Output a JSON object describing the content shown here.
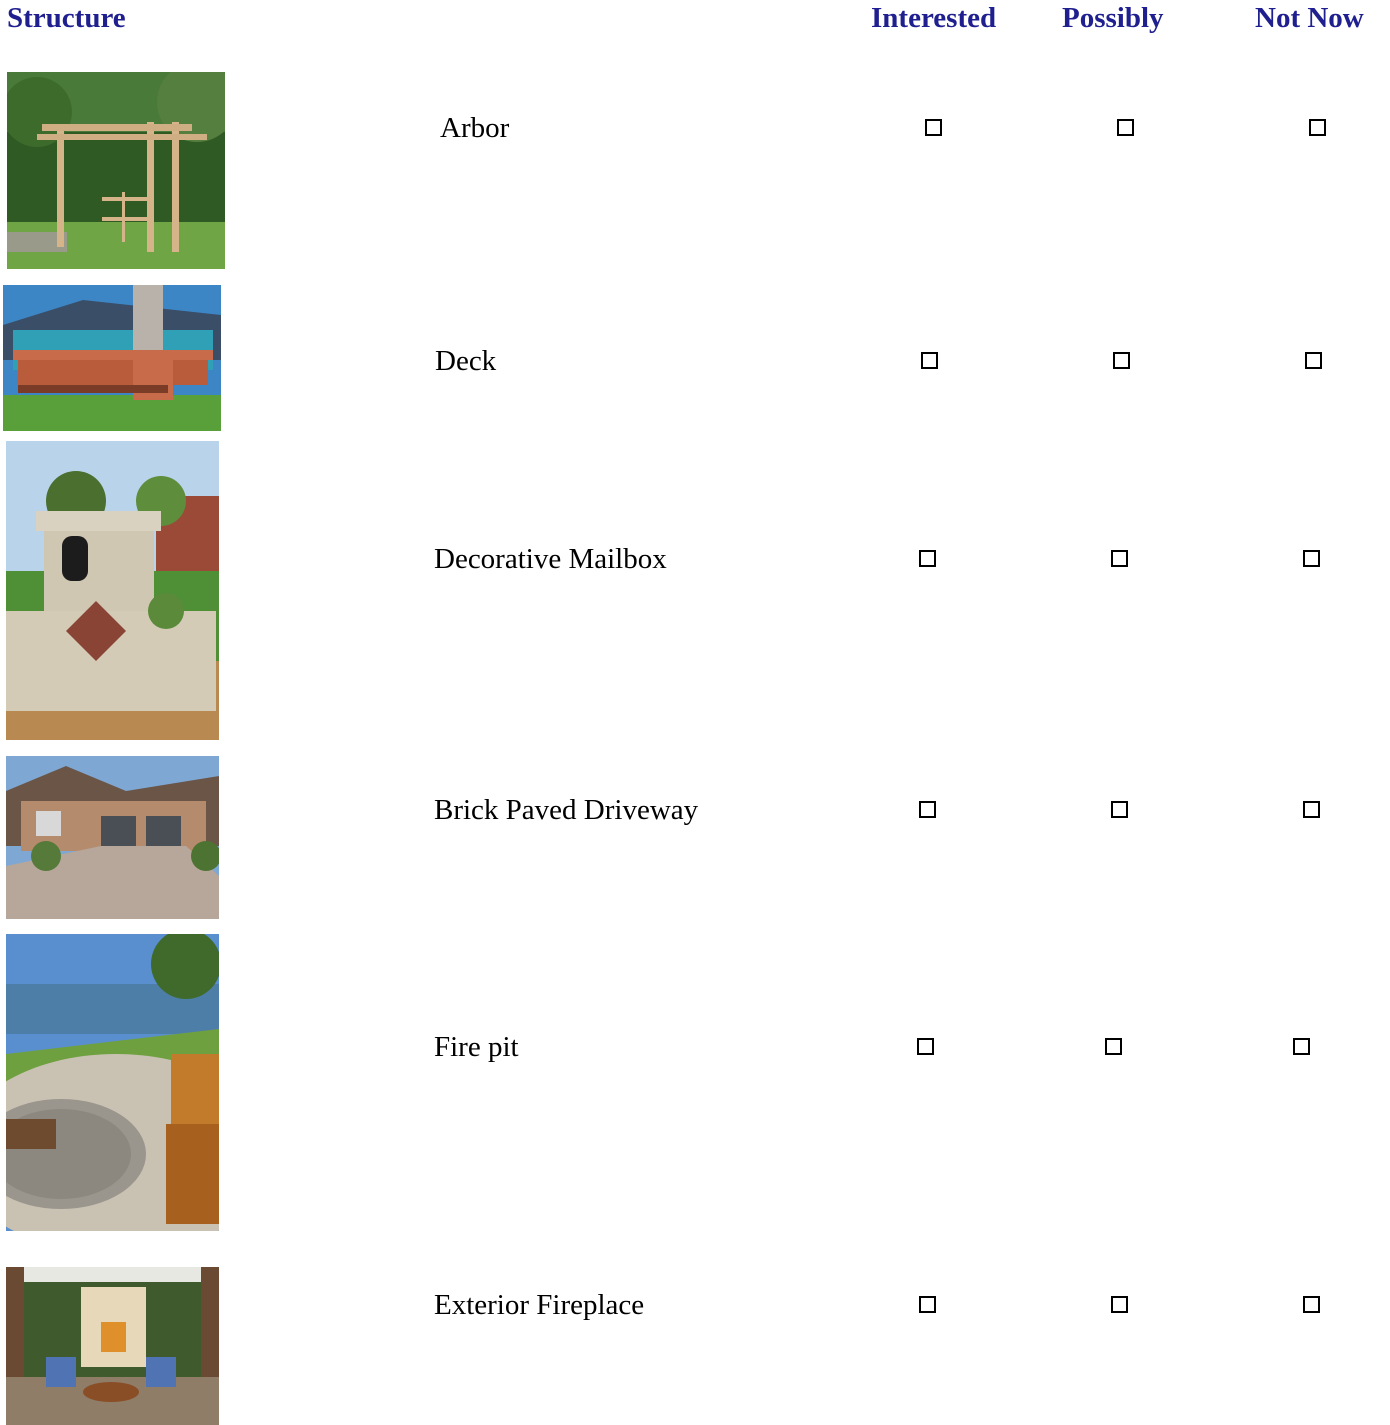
{
  "header": {
    "structure": "Structure",
    "interested": "Interested",
    "possibly": "Possibly",
    "not_now": "Not Now"
  },
  "rows": [
    {
      "label": "Arbor",
      "image": "arbor-photo"
    },
    {
      "label": "Deck",
      "image": "deck-photo"
    },
    {
      "label": "Decorative Mailbox",
      "image": "mailbox-photo"
    },
    {
      "label": "Brick Paved Driveway",
      "image": "driveway-photo"
    },
    {
      "label": "Fire pit",
      "image": "fire-pit-photo"
    },
    {
      "label": "Exterior Fireplace",
      "image": "fireplace-photo"
    }
  ],
  "colors": {
    "header": "#1f1f8f"
  }
}
